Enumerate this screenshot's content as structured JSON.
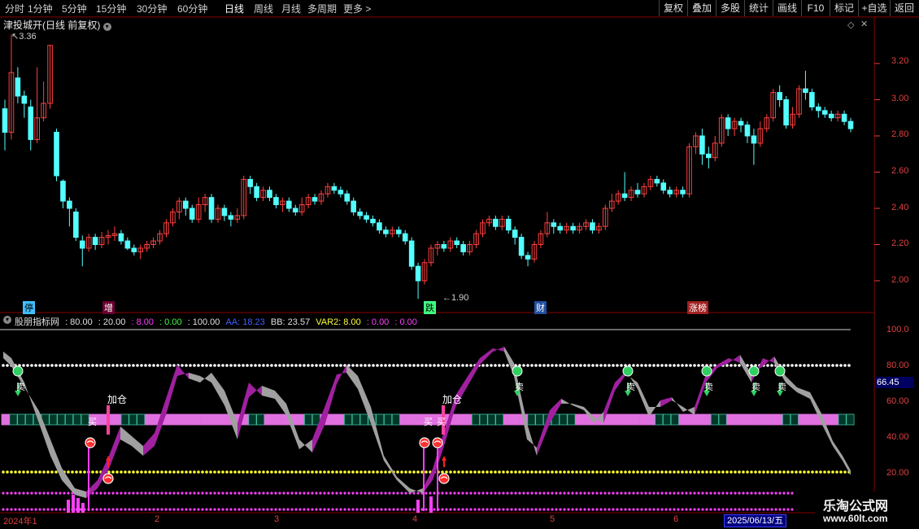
{
  "toolbar": {
    "periods": [
      "分时",
      "1分钟",
      "5分钟",
      "15分钟",
      "30分钟",
      "60分钟",
      "日线",
      "周线",
      "月线",
      "多周期",
      "更多 >"
    ],
    "active_period": "日线",
    "right_buttons": [
      "复权",
      "叠加",
      "多股",
      "统计",
      "画线",
      "F10",
      "标记",
      "+自选",
      "返回"
    ]
  },
  "main_chart": {
    "title": "津投城开(日线 前复权)",
    "high_label": "3.36",
    "low_label": "1.90",
    "y_ticks": [
      "3.20",
      "3.00",
      "2.80",
      "2.60",
      "2.40",
      "2.20",
      "2.00"
    ],
    "event_tags": [
      "停",
      "增",
      "跌",
      "财",
      "涨榜"
    ]
  },
  "indicator": {
    "name": "股朋指标网",
    "values": [
      {
        "text": ": 80.00",
        "color": "#e0e0e0"
      },
      {
        "text": ": 20.00",
        "color": "#e0e0e0"
      },
      {
        "text": ": 8.00",
        "color": "#ff40ff"
      },
      {
        "text": ": 0.00",
        "color": "#40ff40"
      },
      {
        "text": ": 100.00",
        "color": "#e0e0e0"
      },
      {
        "text": "AA: 18.23",
        "color": "#4060ff"
      },
      {
        "text": "BB: 23.57",
        "color": "#e0e0e0"
      },
      {
        "text": "VAR2: 8.00",
        "color": "#ffff40"
      },
      {
        "text": ": 0.00",
        "color": "#ff40ff"
      },
      {
        "text": ": 0.00",
        "color": "#ff40ff"
      }
    ],
    "y_ticks": [
      "100.0",
      "80.00",
      "60.00",
      "40.00",
      "20.00"
    ],
    "current_value": "66.45",
    "signals": {
      "add": "加仓",
      "buy": "买",
      "sell": "卖"
    }
  },
  "x_axis": {
    "labels": [
      "2024年1",
      "2",
      "3",
      "4",
      "5",
      "6"
    ],
    "cursor_date": "2025/06/13/五"
  },
  "watermark": {
    "line1": "乐淘公式网",
    "line2": "www.60lt.com"
  },
  "colors": {
    "up": "#ff4040",
    "down": "#54ffff",
    "purple": "#a020a0",
    "grey": "#a0a0a0",
    "axis": "#e04040"
  },
  "chart_data": {
    "type": "candlestick",
    "title": "津投城开(日线 前复权)",
    "ylim": [
      1.85,
      3.45
    ],
    "candles": [
      [
        2.95,
        2.82,
        3.0,
        2.72
      ],
      [
        2.82,
        3.15,
        3.36,
        2.78
      ],
      [
        3.12,
        3.02,
        3.18,
        2.98
      ],
      [
        3.02,
        2.98,
        3.05,
        2.9
      ],
      [
        2.96,
        2.78,
        3.0,
        2.72
      ],
      [
        2.78,
        2.9,
        3.18,
        2.76
      ],
      [
        2.9,
        2.98,
        3.1,
        2.88
      ],
      [
        2.98,
        3.3,
        3.3,
        2.95
      ],
      [
        2.82,
        2.58,
        2.84,
        2.55
      ],
      [
        2.55,
        2.44,
        2.56,
        2.4
      ],
      [
        2.44,
        2.4,
        2.46,
        2.3
      ],
      [
        2.38,
        2.24,
        2.4,
        2.22
      ],
      [
        2.22,
        2.18,
        2.25,
        2.08
      ],
      [
        2.18,
        2.24,
        2.26,
        2.16
      ],
      [
        2.24,
        2.2,
        2.26,
        2.17
      ],
      [
        2.2,
        2.24,
        2.27,
        2.18
      ],
      [
        2.24,
        2.25,
        2.28,
        2.2
      ],
      [
        2.25,
        2.26,
        2.3,
        2.22
      ],
      [
        2.26,
        2.22,
        2.28,
        2.2
      ],
      [
        2.22,
        2.18,
        2.24,
        2.17
      ],
      [
        2.18,
        2.16,
        2.2,
        2.14
      ],
      [
        2.16,
        2.18,
        2.2,
        2.12
      ],
      [
        2.18,
        2.2,
        2.22,
        2.16
      ],
      [
        2.2,
        2.22,
        2.24,
        2.18
      ],
      [
        2.22,
        2.26,
        2.28,
        2.2
      ],
      [
        2.26,
        2.32,
        2.34,
        2.24
      ],
      [
        2.32,
        2.38,
        2.4,
        2.3
      ],
      [
        2.38,
        2.44,
        2.46,
        2.34
      ],
      [
        2.44,
        2.4,
        2.46,
        2.36
      ],
      [
        2.4,
        2.34,
        2.42,
        2.32
      ],
      [
        2.34,
        2.42,
        2.46,
        2.32
      ],
      [
        2.42,
        2.46,
        2.48,
        2.38
      ],
      [
        2.46,
        2.34,
        2.48,
        2.32
      ],
      [
        2.34,
        2.4,
        2.42,
        2.32
      ],
      [
        2.4,
        2.36,
        2.42,
        2.33
      ],
      [
        2.36,
        2.34,
        2.38,
        2.3
      ],
      [
        2.34,
        2.36,
        2.4,
        2.32
      ],
      [
        2.36,
        2.56,
        2.58,
        2.34
      ],
      [
        2.56,
        2.52,
        2.58,
        2.48
      ],
      [
        2.52,
        2.46,
        2.54,
        2.44
      ],
      [
        2.46,
        2.5,
        2.52,
        2.44
      ],
      [
        2.5,
        2.46,
        2.52,
        2.44
      ],
      [
        2.46,
        2.42,
        2.48,
        2.4
      ],
      [
        2.42,
        2.44,
        2.46,
        2.38
      ],
      [
        2.44,
        2.4,
        2.46,
        2.38
      ],
      [
        2.4,
        2.38,
        2.42,
        2.36
      ],
      [
        2.38,
        2.42,
        2.46,
        2.36
      ],
      [
        2.42,
        2.46,
        2.48,
        2.4
      ],
      [
        2.46,
        2.44,
        2.48,
        2.42
      ],
      [
        2.44,
        2.48,
        2.5,
        2.42
      ],
      [
        2.48,
        2.52,
        2.54,
        2.46
      ],
      [
        2.52,
        2.5,
        2.54,
        2.48
      ],
      [
        2.5,
        2.48,
        2.52,
        2.46
      ],
      [
        2.48,
        2.44,
        2.5,
        2.42
      ],
      [
        2.44,
        2.38,
        2.46,
        2.36
      ],
      [
        2.38,
        2.36,
        2.4,
        2.34
      ],
      [
        2.36,
        2.34,
        2.38,
        2.32
      ],
      [
        2.34,
        2.32,
        2.36,
        2.3
      ],
      [
        2.32,
        2.28,
        2.34,
        2.26
      ],
      [
        2.28,
        2.26,
        2.3,
        2.24
      ],
      [
        2.26,
        2.28,
        2.3,
        2.24
      ],
      [
        2.28,
        2.26,
        2.3,
        2.24
      ],
      [
        2.26,
        2.22,
        2.28,
        2.2
      ],
      [
        2.22,
        2.08,
        2.24,
        2.06
      ],
      [
        2.08,
        2.0,
        2.1,
        1.9
      ],
      [
        2.0,
        2.1,
        2.12,
        1.98
      ],
      [
        2.1,
        2.18,
        2.2,
        2.08
      ],
      [
        2.18,
        2.2,
        2.22,
        2.14
      ],
      [
        2.2,
        2.18,
        2.22,
        2.16
      ],
      [
        2.18,
        2.22,
        2.24,
        2.16
      ],
      [
        2.22,
        2.2,
        2.24,
        2.18
      ],
      [
        2.2,
        2.16,
        2.22,
        2.14
      ],
      [
        2.16,
        2.2,
        2.22,
        2.14
      ],
      [
        2.2,
        2.26,
        2.28,
        2.18
      ],
      [
        2.26,
        2.32,
        2.34,
        2.24
      ],
      [
        2.32,
        2.34,
        2.36,
        2.3
      ],
      [
        2.34,
        2.3,
        2.36,
        2.28
      ],
      [
        2.3,
        2.34,
        2.36,
        2.28
      ],
      [
        2.34,
        2.28,
        2.36,
        2.26
      ],
      [
        2.28,
        2.24,
        2.3,
        2.2
      ],
      [
        2.24,
        2.14,
        2.26,
        2.12
      ],
      [
        2.14,
        2.12,
        2.16,
        2.08
      ],
      [
        2.12,
        2.2,
        2.22,
        2.1
      ],
      [
        2.2,
        2.26,
        2.28,
        2.18
      ],
      [
        2.26,
        2.32,
        2.38,
        2.24
      ],
      [
        2.32,
        2.3,
        2.34,
        2.26
      ],
      [
        2.3,
        2.28,
        2.32,
        2.26
      ],
      [
        2.28,
        2.3,
        2.32,
        2.26
      ],
      [
        2.3,
        2.28,
        2.32,
        2.26
      ],
      [
        2.28,
        2.3,
        2.32,
        2.26
      ],
      [
        2.3,
        2.32,
        2.34,
        2.28
      ],
      [
        2.32,
        2.28,
        2.34,
        2.26
      ],
      [
        2.28,
        2.3,
        2.32,
        2.26
      ],
      [
        2.3,
        2.4,
        2.42,
        2.28
      ],
      [
        2.4,
        2.44,
        2.48,
        2.38
      ],
      [
        2.44,
        2.48,
        2.5,
        2.42
      ],
      [
        2.48,
        2.46,
        2.6,
        2.44
      ],
      [
        2.46,
        2.5,
        2.52,
        2.44
      ],
      [
        2.5,
        2.48,
        2.54,
        2.46
      ],
      [
        2.48,
        2.52,
        2.54,
        2.46
      ],
      [
        2.52,
        2.56,
        2.58,
        2.5
      ],
      [
        2.56,
        2.54,
        2.58,
        2.52
      ],
      [
        2.54,
        2.5,
        2.56,
        2.48
      ],
      [
        2.5,
        2.48,
        2.52,
        2.46
      ],
      [
        2.48,
        2.5,
        2.52,
        2.46
      ],
      [
        2.5,
        2.48,
        2.52,
        2.46
      ],
      [
        2.48,
        2.74,
        2.76,
        2.46
      ],
      [
        2.74,
        2.8,
        2.82,
        2.7
      ],
      [
        2.8,
        2.7,
        2.84,
        2.64
      ],
      [
        2.7,
        2.68,
        2.74,
        2.62
      ],
      [
        2.68,
        2.76,
        2.8,
        2.66
      ],
      [
        2.76,
        2.9,
        2.92,
        2.74
      ],
      [
        2.9,
        2.84,
        2.92,
        2.8
      ],
      [
        2.84,
        2.88,
        2.9,
        2.8
      ],
      [
        2.88,
        2.86,
        2.9,
        2.82
      ],
      [
        2.86,
        2.8,
        2.88,
        2.76
      ],
      [
        2.8,
        2.76,
        2.84,
        2.64
      ],
      [
        2.76,
        2.84,
        2.88,
        2.74
      ],
      [
        2.84,
        2.9,
        2.92,
        2.82
      ],
      [
        2.9,
        3.04,
        3.06,
        2.88
      ],
      [
        3.04,
        3.0,
        3.08,
        2.96
      ],
      [
        3.0,
        2.86,
        3.02,
        2.84
      ],
      [
        2.86,
        2.92,
        2.96,
        2.84
      ],
      [
        2.92,
        3.06,
        3.08,
        2.9
      ],
      [
        3.06,
        3.04,
        3.16,
        3.0
      ],
      [
        3.04,
        2.96,
        3.06,
        2.94
      ],
      [
        2.96,
        2.94,
        2.98,
        2.9
      ],
      [
        2.94,
        2.92,
        2.96,
        2.9
      ],
      [
        2.92,
        2.9,
        2.94,
        2.88
      ],
      [
        2.9,
        2.92,
        2.94,
        2.88
      ],
      [
        2.92,
        2.88,
        2.94,
        2.86
      ],
      [
        2.88,
        2.84,
        2.9,
        2.82
      ]
    ]
  }
}
